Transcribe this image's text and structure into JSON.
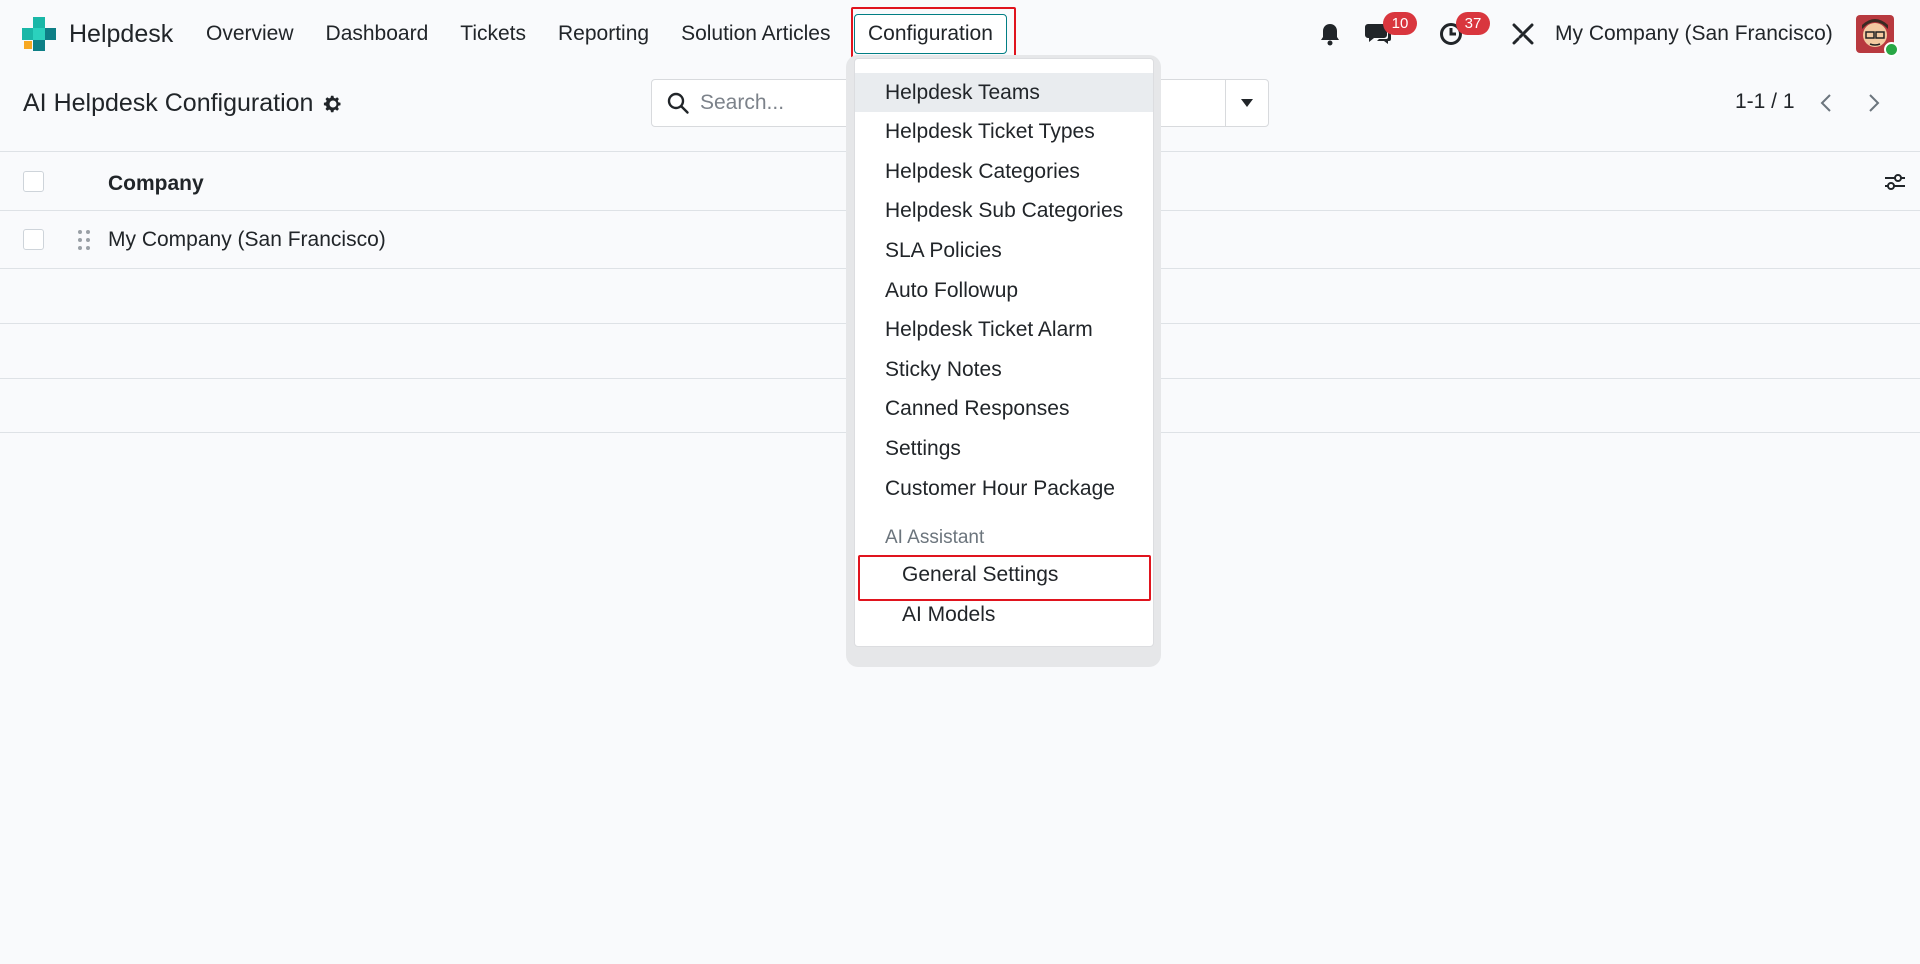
{
  "app": {
    "name": "Helpdesk"
  },
  "nav": {
    "items": [
      "Overview",
      "Dashboard",
      "Tickets",
      "Reporting",
      "Solution Articles"
    ],
    "config_label": "Configuration"
  },
  "systray": {
    "messages_count": "10",
    "activities_count": "37",
    "company": "My Company (San Francisco)"
  },
  "control_panel": {
    "title": "AI Helpdesk Configuration",
    "search_placeholder": "Search...",
    "pager": "1-1 / 1"
  },
  "list": {
    "column_company": "Company",
    "rows": [
      "My Company (San Francisco)"
    ]
  },
  "dropdown": {
    "items": [
      "Helpdesk Teams",
      "Helpdesk Ticket Types",
      "Helpdesk Categories",
      "Helpdesk Sub Categories",
      "SLA Policies",
      "Auto Followup",
      "Helpdesk Ticket Alarm",
      "Sticky Notes",
      "Canned Responses",
      "Settings",
      "Customer Hour Package"
    ],
    "section": "AI Assistant",
    "sub_items": [
      "General Settings",
      "AI Models"
    ]
  },
  "colors": {
    "brand_teal": "#017e84",
    "highlight_red": "#e0141e",
    "badge_red": "#d9363e"
  }
}
